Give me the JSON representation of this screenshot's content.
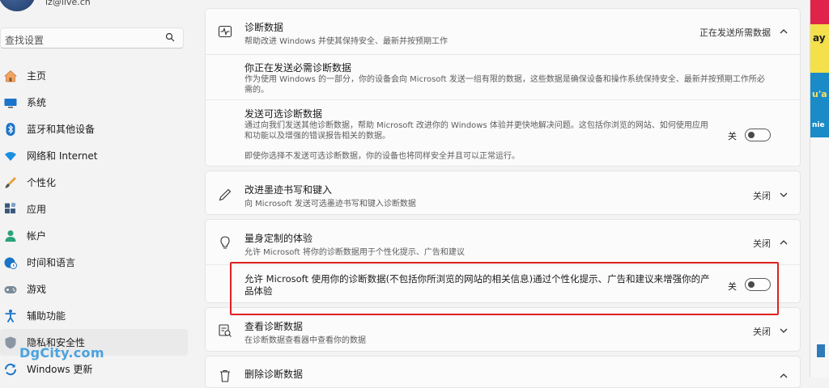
{
  "account": {
    "email": "iz@live.cn"
  },
  "search": {
    "placeholder": "查找设置"
  },
  "nav": [
    {
      "label": "主页",
      "icon": "home-icon"
    },
    {
      "label": "系统",
      "icon": "monitor-icon"
    },
    {
      "label": "蓝牙和其他设备",
      "icon": "bluetooth-icon"
    },
    {
      "label": "网络和 Internet",
      "icon": "wifi-icon"
    },
    {
      "label": "个性化",
      "icon": "brush-icon"
    },
    {
      "label": "应用",
      "icon": "apps-icon"
    },
    {
      "label": "帐户",
      "icon": "person-icon"
    },
    {
      "label": "时间和语言",
      "icon": "globe-clock-icon"
    },
    {
      "label": "游戏",
      "icon": "gamepad-icon"
    },
    {
      "label": "辅助功能",
      "icon": "accessibility-icon"
    },
    {
      "label": "隐私和安全性",
      "icon": "shield-icon",
      "active": true
    },
    {
      "label": "Windows 更新",
      "icon": "update-icon"
    }
  ],
  "watermark": "DgCity.com",
  "diag": {
    "title": "诊断数据",
    "sub": "帮助改进 Windows 并使其保持安全、最新并按预期工作",
    "status": "正在发送所需数据",
    "required_title": "你正在发送必需诊断数据",
    "required_desc": "作为使用 Windows 的一部分，你的设备会向 Microsoft 发送一组有限的数据，这些数据是确保设备和操作系统保持安全、最新并按预期工作所必需的。",
    "optional_title": "发送可选诊断数据",
    "optional_desc": "通过向我们发送其他诊断数据，帮助 Microsoft 改进你的 Windows 体验并更快地解决问题。这包括你浏览的网站、如何使用应用和功能以及增强的错误报告相关的数据。",
    "optional_note": "即使你选择不发送可选诊断数据，你的设备也将同样安全并且可以正常运行。",
    "optional_toggle": "关"
  },
  "ink": {
    "title": "改进墨迹书写和键入",
    "sub": "向 Microsoft 发送可选墨迹书写和键入诊断数据",
    "status": "关闭"
  },
  "tailored": {
    "title": "量身定制的体验",
    "sub": "允许 Microsoft 将你的诊断数据用于个性化提示、广告和建议",
    "status": "关闭",
    "detail": "允许 Microsoft 使用你的诊断数据(不包括你所浏览的网站的相关信息)通过个性化提示、广告和建议来增强你的产品体验",
    "toggle": "关"
  },
  "viewer": {
    "title": "查看诊断数据",
    "sub": "在诊断数据查看器中查看你的数据",
    "status": "关闭"
  },
  "delete": {
    "title": "删除诊断数据"
  },
  "edge_strip": {
    "t1": "ay",
    "t2": "u'a",
    "t3": "nie"
  },
  "colors": {
    "highlight": "#e02020",
    "watermark": "#4aa3df"
  }
}
